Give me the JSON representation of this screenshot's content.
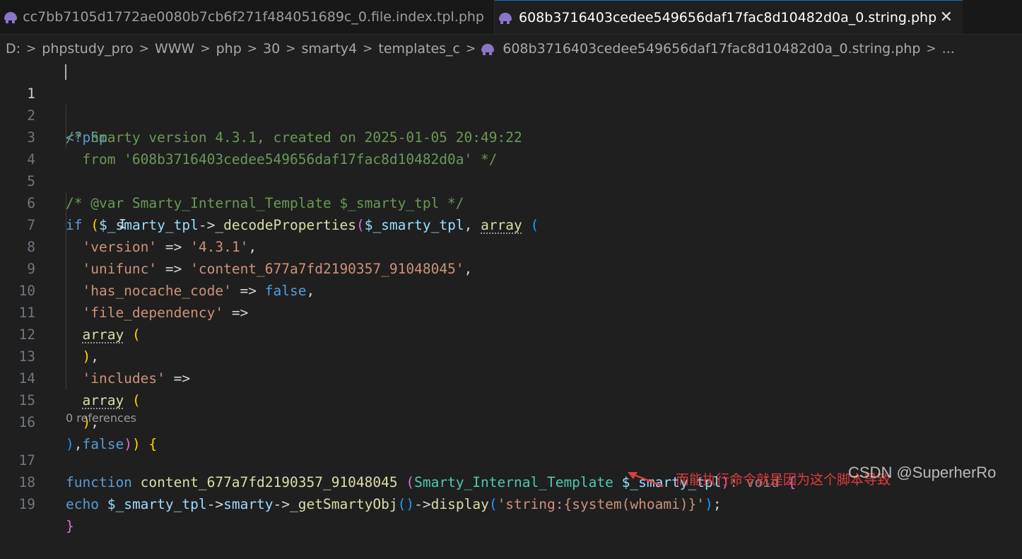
{
  "tabs": [
    {
      "label": "cc7bb7105d1772ae0080b7cb6f271f484051689c_0.file.index.tpl.php",
      "icon": "php-elephant-icon",
      "active": false
    },
    {
      "label": "608b3716403cedee549656daf17fac8d10482d0a_0.string.php",
      "icon": "php-elephant-icon",
      "active": true,
      "close": "✕"
    }
  ],
  "breadcrumb": {
    "items": [
      "D:",
      "phpstudy_pro",
      "WWW",
      "php",
      "30",
      "smarty4",
      "templates_c",
      "608b3716403cedee549656daf17fac8d10482d0a_0.string.php",
      "..."
    ],
    "separator": ">"
  },
  "editor": {
    "line_numbers": [
      "1",
      "2",
      "3",
      "4",
      "5",
      "6",
      "7",
      "8",
      "9",
      "10",
      "11",
      "12",
      "13",
      "14",
      "15",
      "16",
      "17",
      "18",
      "19"
    ],
    "current_line": "1",
    "codelens": "0 references",
    "text": {
      "l1_open": "<?php",
      "l2": "/* Smarty version 4.3.1, created on 2025-01-05 20:49:22",
      "l3": "  from '608b3716403cedee549656daf17fac8d10482d0a' */",
      "l5": "/* @var Smarty_Internal_Template $_smarty_tpl */",
      "l6_if": "if",
      "l6_var1": "$_smarty_tpl",
      "l6_arrow": "->",
      "l6_fn": "_decodeProperties",
      "l6_var2": "$_smarty_tpl",
      "l6_array": "array",
      "l7_key": "'version'",
      "l7_val": "'4.3.1'",
      "l8_key": "'unifunc'",
      "l8_val": "'content_677a7fd2190357_91048045'",
      "l9_key": "'has_nocache_code'",
      "l9_val": "false",
      "l10_key": "'file_dependency'",
      "l11_array": "array",
      "l13_key": "'includes'",
      "l14_array": "array",
      "l16_false": "false",
      "l17_kw": "function",
      "l17_fn": "content_677a7fd2190357_91048045",
      "l17_type": "Smarty_Internal_Template",
      "l17_var": "$_smarty_tpl",
      "l17_hint": ": void",
      "l18_echo": "echo",
      "l18_var": "$_smarty_tpl",
      "l18_prop": "smarty",
      "l18_fn1": "_getSmartyObj",
      "l18_fn2": "display",
      "l18_str": "'string:{system(whoami)}'"
    }
  },
  "annotation": {
    "text": "而能执行命令就是因为这个脚本导致",
    "color": "#e23b3b"
  },
  "watermark": "CSDN @SuperherRo"
}
